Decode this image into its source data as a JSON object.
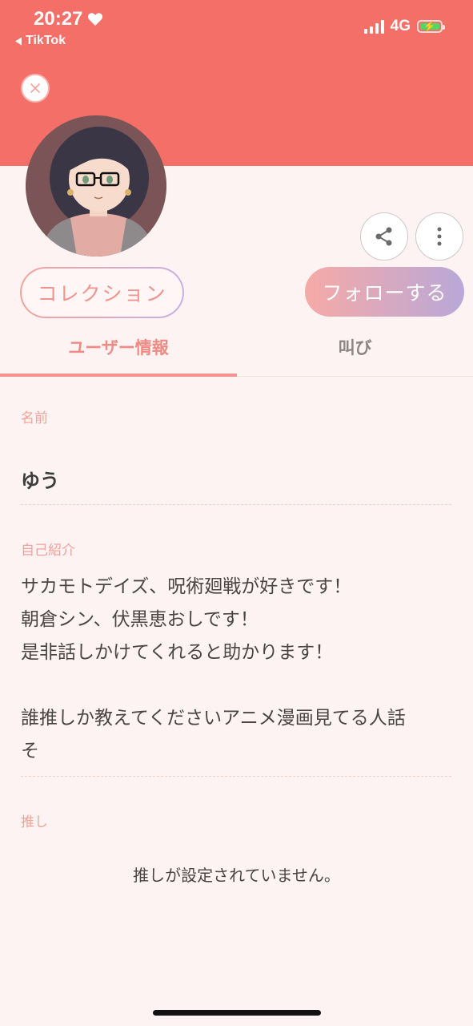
{
  "status_bar": {
    "time": "20:27",
    "back_app": "TikTok",
    "network": "4G"
  },
  "profile": {
    "collection_label": "コレクション",
    "follow_label": "フォローする"
  },
  "tabs": [
    {
      "label": "ユーザー情報",
      "active": true
    },
    {
      "label": "叫び",
      "active": false
    }
  ],
  "user_info": {
    "name_label": "名前",
    "name_value": "ゆう",
    "bio_label": "自己紹介",
    "bio_text": "サカモトデイズ、呪術廻戦が好きです！\n朝倉シン、伏黒恵おしです！\n是非話しかけてくれると助かります！\n\n誰推しか教えてくださいアニメ漫画見てる人話\nそ",
    "oshi_label": "推し",
    "oshi_empty": "推しが設定されていません。"
  },
  "colors": {
    "header": "#f46f68",
    "background": "#fdf3f2",
    "accent": "#f08a84",
    "label": "#f3a29b"
  },
  "icons": {
    "close": "close-icon",
    "share": "share-icon",
    "more": "more-vertical-icon",
    "heart": "heart-icon",
    "back": "back-triangle-icon"
  }
}
